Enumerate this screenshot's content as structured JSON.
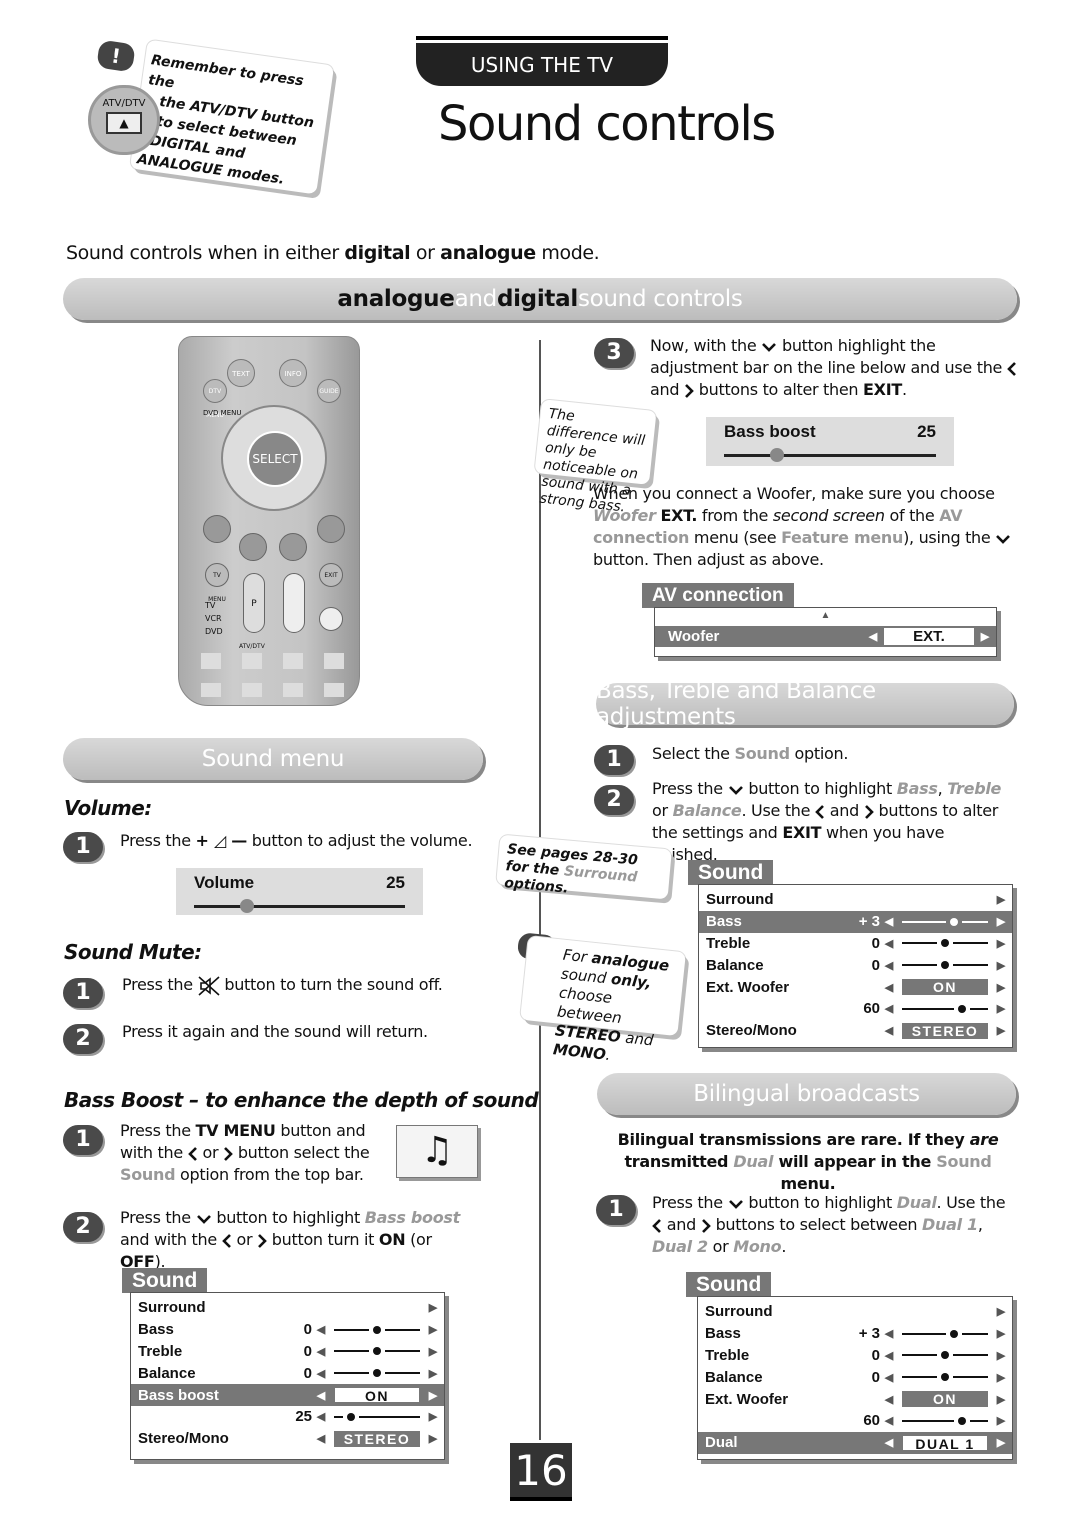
{
  "header": {
    "section_tab": "USING THE TV",
    "title": "Sound controls",
    "intro": [
      {
        "t": "Sound controls when in either "
      },
      {
        "t": "digital",
        "s": "b"
      },
      {
        "t": " or "
      },
      {
        "t": "analogue",
        "s": "b"
      },
      {
        "t": " mode."
      }
    ]
  },
  "reminder": {
    "badge": "!",
    "button_label": "ATV/DTV",
    "lines": [
      "Remember to press the",
      "the ATV/DTV button",
      "to select between",
      "DIGITAL and",
      "ANALOGUE modes."
    ]
  },
  "banners": {
    "main": [
      {
        "t": "analogue",
        "s": "dk"
      },
      {
        "t": " and "
      },
      {
        "t": "digital",
        "s": "dk"
      },
      {
        "t": " sound controls"
      }
    ],
    "sound_menu": "Sound menu",
    "btb": "Bass, Treble and Balance adjustments",
    "bilingual": "Bilingual broadcasts"
  },
  "remote": {
    "buttons": [
      "TEXT",
      "INFO",
      "DTV MENU",
      "GUIDE",
      "DVD MENU",
      "SELECT",
      "TV MENU",
      "EXIT",
      "P",
      "TV",
      "VCR",
      "DVD",
      "ATV/DTV"
    ]
  },
  "volume": {
    "heading": "Volume:",
    "step1": "1",
    "text": [
      {
        "t": "Press the "
      },
      {
        "t": "+ ◿ —",
        "s": "b"
      },
      {
        "t": " button to adjust the volume."
      }
    ],
    "box_label": "Volume",
    "box_value": "25",
    "level": 0.25
  },
  "mute": {
    "heading": "Sound Mute:",
    "step1": "1",
    "text1": [
      {
        "t": "Press the "
      },
      {
        "icon": "mute"
      },
      {
        "t": " button to turn the sound off."
      }
    ],
    "step2": "2",
    "text2": [
      {
        "t": "Press it again and the sound will return."
      }
    ]
  },
  "bassboost": {
    "heading": "Bass Boost – to enhance the depth of sound",
    "step1": "1",
    "text1": [
      {
        "t": "Press the "
      },
      {
        "t": "TV MENU",
        "s": "b"
      },
      {
        "t": " button and with the "
      },
      {
        "icon": "left"
      },
      {
        "t": " or "
      },
      {
        "icon": "right"
      },
      {
        "t": " button select the "
      },
      {
        "t": "Sound",
        "s": "hn"
      },
      {
        "t": " option from the top bar."
      }
    ],
    "step2": "2",
    "text2": [
      {
        "t": "Press the "
      },
      {
        "icon": "down"
      },
      {
        "t": " button to highlight "
      },
      {
        "t": "Bass boost",
        "s": "h"
      },
      {
        "t": " and with the "
      },
      {
        "icon": "left"
      },
      {
        "t": " or "
      },
      {
        "icon": "right"
      },
      {
        "t": " button turn it "
      },
      {
        "t": "ON",
        "s": "b"
      },
      {
        "t": " (or "
      },
      {
        "t": "OFF",
        "s": "b"
      },
      {
        "t": ")."
      }
    ]
  },
  "menu1": {
    "tab": "Sound",
    "rows": [
      {
        "label": "Surround"
      },
      {
        "label": "Bass",
        "value": "0",
        "slider": 0.5
      },
      {
        "label": "Treble",
        "value": "0",
        "slider": 0.5
      },
      {
        "label": "Balance",
        "value": "0",
        "slider": 0.5
      },
      {
        "label": "Bass boost",
        "button": "ON",
        "white": true,
        "hl": true
      },
      {
        "label": "",
        "value": "25",
        "slider": 0.2
      },
      {
        "label": "Stereo/Mono",
        "button": "STEREO"
      }
    ]
  },
  "step3": {
    "num": "3",
    "text": [
      {
        "t": "Now, with the "
      },
      {
        "icon": "down"
      },
      {
        "t": " button highlight the adjustment bar on the line below and use the "
      },
      {
        "icon": "left"
      },
      {
        "t": " and "
      },
      {
        "icon": "right"
      },
      {
        "t": " buttons to alter then "
      },
      {
        "t": "EXIT",
        "s": "b"
      },
      {
        "t": "."
      }
    ]
  },
  "note_difference": "The difference will only be noticeable on sound with a strong bass.",
  "bassbox": {
    "label": "Bass boost",
    "value": "25",
    "level": 0.25
  },
  "woofer_text": [
    {
      "t": "When you connect a Woofer, make sure you choose "
    },
    {
      "t": "Woofer",
      "s": "h"
    },
    {
      "t": " "
    },
    {
      "t": "EXT.",
      "s": "b"
    },
    {
      "t": " from the "
    },
    {
      "t": "second screen",
      "s": "i"
    },
    {
      "t": " of the "
    },
    {
      "t": "AV connection",
      "s": "hn"
    },
    {
      "t": " menu (see "
    },
    {
      "t": "Feature menu",
      "s": "hn"
    },
    {
      "t": "), using the "
    },
    {
      "icon": "down"
    },
    {
      "t": " button. Then adjust as above."
    }
  ],
  "av": {
    "tab": "AV connection",
    "row_label": "Woofer",
    "row_value": "EXT."
  },
  "btb": {
    "step1": "1",
    "text1": [
      {
        "t": "Select the "
      },
      {
        "t": "Sound",
        "s": "hn"
      },
      {
        "t": " option."
      }
    ],
    "step2": "2",
    "text2": [
      {
        "t": "Press the "
      },
      {
        "icon": "down"
      },
      {
        "t": " button to highlight "
      },
      {
        "t": "Bass",
        "s": "h"
      },
      {
        "t": ", "
      },
      {
        "t": "Treble",
        "s": "h"
      },
      {
        "t": " or "
      },
      {
        "t": "Balance",
        "s": "h"
      },
      {
        "t": ". Use the "
      },
      {
        "icon": "left"
      },
      {
        "t": " and "
      },
      {
        "icon": "right"
      },
      {
        "t": " buttons to alter the settings and "
      },
      {
        "t": "EXIT",
        "s": "b"
      },
      {
        "t": " when you have finished."
      }
    ]
  },
  "note_pages": [
    {
      "t": "See pages "
    },
    {
      "t": "28-30",
      "s": "b"
    },
    {
      "t": " for the "
    },
    {
      "t": "Surround",
      "s": "hn"
    },
    {
      "t": " options."
    }
  ],
  "note_analogue": [
    {
      "t": "For "
    },
    {
      "t": "analogue",
      "s": "b"
    },
    {
      "t": " sound "
    },
    {
      "t": "only,",
      "s": "b"
    },
    {
      "t": " choose between "
    },
    {
      "t": "STEREO",
      "s": "b"
    },
    {
      "t": " and "
    },
    {
      "t": "MONO",
      "s": "b"
    },
    {
      "t": "."
    }
  ],
  "menu2": {
    "tab": "Sound",
    "rows": [
      {
        "label": "Surround"
      },
      {
        "label": "Bass",
        "value": "+ 3",
        "slider": 0.6,
        "hl": true
      },
      {
        "label": "Treble",
        "value": "0",
        "slider": 0.5
      },
      {
        "label": "Balance",
        "value": "0",
        "slider": 0.5
      },
      {
        "label": "Ext.  Woofer",
        "button": "ON"
      },
      {
        "label": "",
        "value": "60",
        "slider": 0.7
      },
      {
        "label": "Stereo/Mono",
        "button": "STEREO"
      }
    ]
  },
  "bilingual": {
    "intro": [
      {
        "t": "Bilingual transmissions are rare. If they "
      },
      {
        "t": "are",
        "s": "i"
      },
      {
        "t": " transmitted "
      },
      {
        "t": "Dual",
        "s": "h"
      },
      {
        "t": " will appear in the "
      },
      {
        "t": "Sound",
        "s": "hn"
      },
      {
        "t": " menu."
      }
    ],
    "step1": "1",
    "text1": [
      {
        "t": "Press the "
      },
      {
        "icon": "down"
      },
      {
        "t": " button to highlight "
      },
      {
        "t": "Dual",
        "s": "h"
      },
      {
        "t": ". Use the "
      },
      {
        "icon": "left"
      },
      {
        "t": " and "
      },
      {
        "icon": "right"
      },
      {
        "t": " buttons to select between "
      },
      {
        "t": "Dual 1",
        "s": "h"
      },
      {
        "t": ", "
      },
      {
        "t": "Dual 2",
        "s": "h"
      },
      {
        "t": " or "
      },
      {
        "t": "Mono",
        "s": "h"
      },
      {
        "t": "."
      }
    ]
  },
  "menu3": {
    "tab": "Sound",
    "rows": [
      {
        "label": "Surround"
      },
      {
        "label": "Bass",
        "value": "+ 3",
        "slider": 0.6
      },
      {
        "label": "Treble",
        "value": "0",
        "slider": 0.5
      },
      {
        "label": "Balance",
        "value": "0",
        "slider": 0.5
      },
      {
        "label": "Ext.  Woofer",
        "button": "ON"
      },
      {
        "label": "",
        "value": "60",
        "slider": 0.7
      },
      {
        "label": "Dual",
        "button": "DUAL 1",
        "white": true,
        "hl": true
      }
    ]
  },
  "page_number": "16"
}
